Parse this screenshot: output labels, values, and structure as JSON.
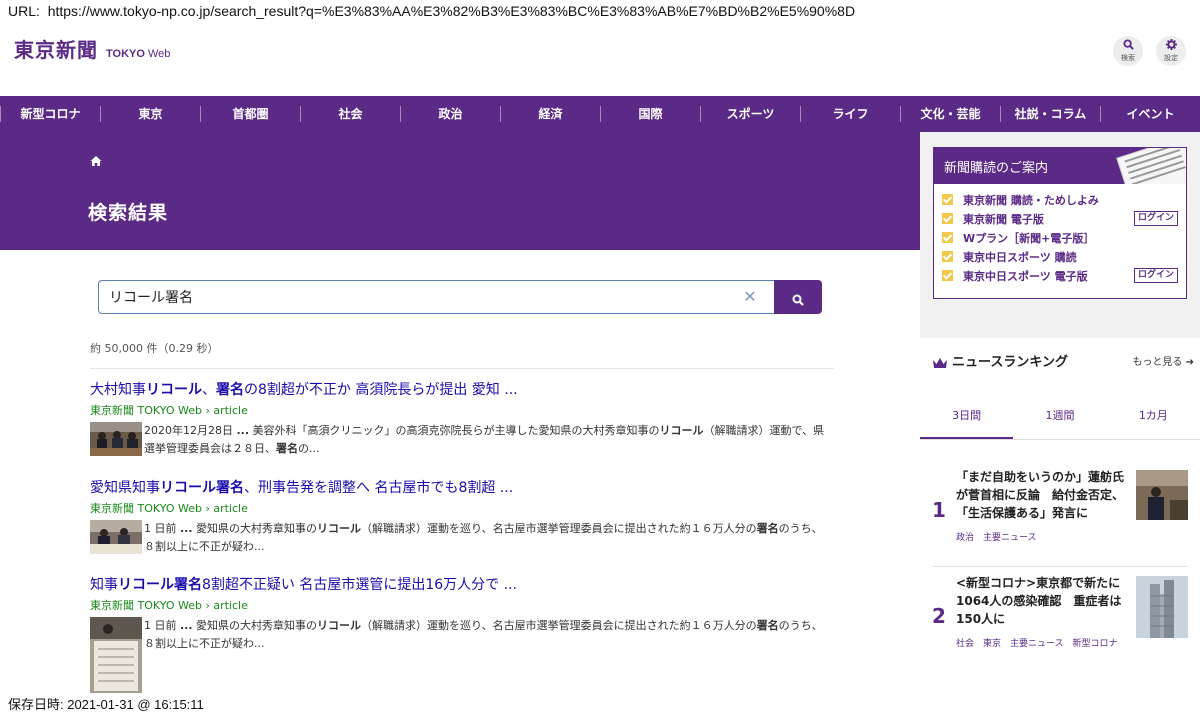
{
  "browser": {
    "url_label": "URL:",
    "url": "https://www.tokyo-np.co.jp/search_result?q=%E3%83%AA%E3%82%B3%E3%83%BC%E3%83%AB%E7%BD%B2%E5%90%8D"
  },
  "header": {
    "logo_jp": "東京新聞",
    "logo_en_bold": "TOKYO",
    "logo_en_light": "Web",
    "search_label": "検索",
    "settings_label": "設定"
  },
  "nav": [
    "新型コロナ",
    "東京",
    "首都圏",
    "社会",
    "政治",
    "経済",
    "国際",
    "スポーツ",
    "ライフ",
    "文化・芸能",
    "社説・コラム",
    "イベント"
  ],
  "hero": {
    "title": "検索結果"
  },
  "search": {
    "value": "リコール署名",
    "clear_glyph": "✕"
  },
  "results_count": "約 50,000 件（0.29 秒）",
  "results": [
    {
      "title_parts": [
        {
          "t": "大村知事",
          "b": false
        },
        {
          "t": "リコール",
          "b": true
        },
        {
          "t": "、",
          "b": false
        },
        {
          "t": "署名",
          "b": true
        },
        {
          "t": "の8割超が不正か 高須院長らが提出 愛知 ...",
          "b": false
        }
      ],
      "source": "東京新聞 TOKYO Web › article",
      "snippet_parts": [
        {
          "t": "2020年12月28日 ",
          "b": false
        },
        {
          "t": "...",
          "b": true
        },
        {
          "t": " 美容外科「高須クリニック」の高須克弥院長らが主導した愛知県の大村秀章知事の",
          "b": false
        },
        {
          "t": "リコール",
          "b": true
        },
        {
          "t": "（解職請求）運動で、県選挙管理委員会は２８日、",
          "b": false
        },
        {
          "t": "署名",
          "b": true
        },
        {
          "t": "の...",
          "b": false
        }
      ]
    },
    {
      "title_parts": [
        {
          "t": "愛知県知事",
          "b": false
        },
        {
          "t": "リコール署名",
          "b": true
        },
        {
          "t": "、刑事告発を調整へ 名古屋市でも8割超 ...",
          "b": false
        }
      ],
      "source": "東京新聞 TOKYO Web › article",
      "snippet_parts": [
        {
          "t": "1 日前 ",
          "b": false
        },
        {
          "t": "...",
          "b": true
        },
        {
          "t": " 愛知県の大村秀章知事の",
          "b": false
        },
        {
          "t": "リコール",
          "b": true
        },
        {
          "t": "（解職請求）運動を巡り、名古屋市選挙管理委員会に提出された約１６万人分の",
          "b": false
        },
        {
          "t": "署名",
          "b": true
        },
        {
          "t": "のうち、８割以上に不正が疑わ...",
          "b": false
        }
      ]
    },
    {
      "title_parts": [
        {
          "t": "知事",
          "b": false
        },
        {
          "t": "リコール署名",
          "b": true
        },
        {
          "t": "8割超不正疑い 名古屋市選管に提出16万人分で ...",
          "b": false
        }
      ],
      "source": "東京新聞 TOKYO Web › article",
      "snippet_parts": [
        {
          "t": "1 日前 ",
          "b": false
        },
        {
          "t": "...",
          "b": true
        },
        {
          "t": " 愛知県の大村秀章知事の",
          "b": false
        },
        {
          "t": "リコール",
          "b": true
        },
        {
          "t": "（解職請求）運動を巡り、名古屋市選挙管理委員会に提出された約１６万人分の",
          "b": false
        },
        {
          "t": "署名",
          "b": true
        },
        {
          "t": "のうち、８割以上に不正が疑わ...",
          "b": false
        }
      ]
    }
  ],
  "subscription": {
    "title": "新聞購読のご案内",
    "items": [
      {
        "label": "東京新聞 購読・ためしよみ",
        "login": ""
      },
      {
        "label": "東京新聞 電子版",
        "login": "ログイン"
      },
      {
        "label": "Wプラン［新聞+電子版］",
        "login": ""
      },
      {
        "label": "東京中日スポーツ 購読",
        "login": ""
      },
      {
        "label": "東京中日スポーツ 電子版",
        "login": "ログイン"
      }
    ]
  },
  "ranking": {
    "title": "ニュースランキング",
    "more": "もっと見る ➔",
    "tabs": [
      {
        "label": "3日間",
        "active": true
      },
      {
        "label": "1週間",
        "active": false
      },
      {
        "label": "1カ月",
        "active": false
      }
    ],
    "items": [
      {
        "rank": "1",
        "text": "「まだ自助をいうのか」蓮舫氏が菅首相に反論　給付金否定、「生活保護ある」発言に",
        "tags": "政治　主要ニュース"
      },
      {
        "rank": "2",
        "text": "<新型コロナ>東京都で新たに1064人の感染確認　重症者は150人に",
        "tags": "社会　東京　主要ニュース　新型コロナ"
      }
    ]
  },
  "footer": {
    "saved": "保存日時:  2021-01-31 @ 16:15:11"
  },
  "colors": {
    "brand_purple": "#5b2a86",
    "link_blue": "#1a0dab",
    "source_green": "#1a8a1a",
    "check_yellow": "#f2c94c"
  }
}
